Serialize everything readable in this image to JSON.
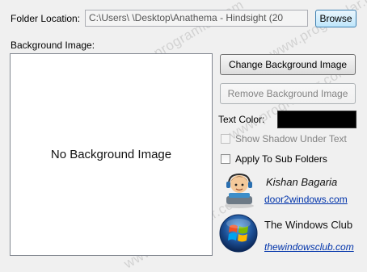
{
  "folder": {
    "label": "Folder Location:",
    "path_value": "C:\\Users\\       \\Desktop\\Anathema - Hindsight (20",
    "browse_label": "Browse"
  },
  "background": {
    "label": "Background Image:",
    "preview_text": "No Background Image",
    "change_label": "Change Background Image",
    "remove_label": "Remove Background Image"
  },
  "text_color": {
    "label": "Text Color:",
    "value": "#000000"
  },
  "options": {
    "show_shadow_label": "Show Shadow Under Text",
    "apply_sub_folders_label": "Apply To Sub Folders"
  },
  "credits": {
    "author_name": "Kishan Bagaria",
    "author_link": "door2windows.com",
    "club_name": "The Windows Club",
    "club_link": "thewindowsclub.com"
  },
  "watermark": "www.programlar.com"
}
